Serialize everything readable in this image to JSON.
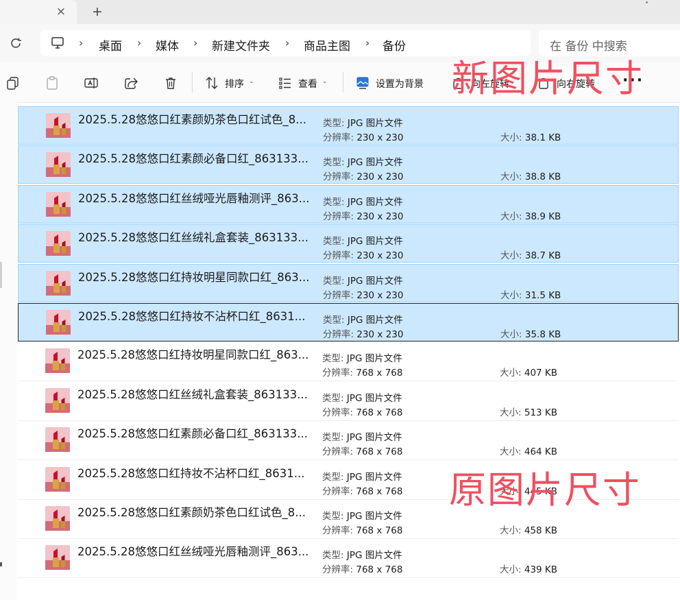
{
  "tab": {
    "close_glyph": "×",
    "new_glyph": "+"
  },
  "breadcrumb": [
    "桌面",
    "媒体",
    "新建文件夹",
    "商品主图",
    "备份"
  ],
  "breadcrumb_sep": "›",
  "search": {
    "placeholder": "在 备份 中搜索"
  },
  "toolbar": {
    "sort_label": "排序",
    "view_label": "查看",
    "set_bg_label": "设置为背景",
    "rotate_left_label": "向左旋转",
    "rotate_right_label": "向右旋转",
    "more_label": "···",
    "chevron": "⌄"
  },
  "labels": {
    "type": "类型:",
    "resolution": "分辨率:",
    "size": "大小:"
  },
  "files": [
    {
      "name": "2025.5.28悠悠口红素颜奶茶色口红试色_8...",
      "type": "JPG 图片文件",
      "resolution": "230 x 230",
      "size": "38.1 KB",
      "selected": true
    },
    {
      "name": "2025.5.28悠悠口红素颜必备口红_863133...",
      "type": "JPG 图片文件",
      "resolution": "230 x 230",
      "size": "38.8 KB",
      "selected": true
    },
    {
      "name": "2025.5.28悠悠口红丝绒哑光唇釉测评_863...",
      "type": "JPG 图片文件",
      "resolution": "230 x 230",
      "size": "38.9 KB",
      "selected": true
    },
    {
      "name": "2025.5.28悠悠口红丝绒礼盒套装_863133...",
      "type": "JPG 图片文件",
      "resolution": "230 x 230",
      "size": "38.7 KB",
      "selected": true
    },
    {
      "name": "2025.5.28悠悠口红持妆明星同款口红_863...",
      "type": "JPG 图片文件",
      "resolution": "230 x 230",
      "size": "31.5 KB",
      "selected": true
    },
    {
      "name": "2025.5.28悠悠口红持妆不沾杯口红_8631...",
      "type": "JPG 图片文件",
      "resolution": "230 x 230",
      "size": "35.8 KB",
      "selected": true,
      "focused": true
    },
    {
      "name": "2025.5.28悠悠口红持妆明星同款口红_863...",
      "type": "JPG 图片文件",
      "resolution": "768 x 768",
      "size": "407 KB",
      "selected": false
    },
    {
      "name": "2025.5.28悠悠口红丝绒礼盒套装_863133...",
      "type": "JPG 图片文件",
      "resolution": "768 x 768",
      "size": "513 KB",
      "selected": false
    },
    {
      "name": "2025.5.28悠悠口红素颜必备口红_863133...",
      "type": "JPG 图片文件",
      "resolution": "768 x 768",
      "size": "464 KB",
      "selected": false
    },
    {
      "name": "2025.5.28悠悠口红持妆不沾杯口红_8631...",
      "type": "JPG 图片文件",
      "resolution": "768 x 768",
      "size": "445 KB",
      "selected": false
    },
    {
      "name": "2025.5.28悠悠口红素颜奶茶色口红试色_8...",
      "type": "JPG 图片文件",
      "resolution": "768 x 768",
      "size": "458 KB",
      "selected": false
    },
    {
      "name": "2025.5.28悠悠口红丝绒哑光唇釉测评_863...",
      "type": "JPG 图片文件",
      "resolution": "768 x 768",
      "size": "439 KB",
      "selected": false
    }
  ],
  "annotations": {
    "top": "新图片尺寸",
    "bottom": "原图片尺寸"
  },
  "colors": {
    "selection": "#cce8ff",
    "annotation": "#ef5060",
    "lipstick": "#c8102e"
  }
}
